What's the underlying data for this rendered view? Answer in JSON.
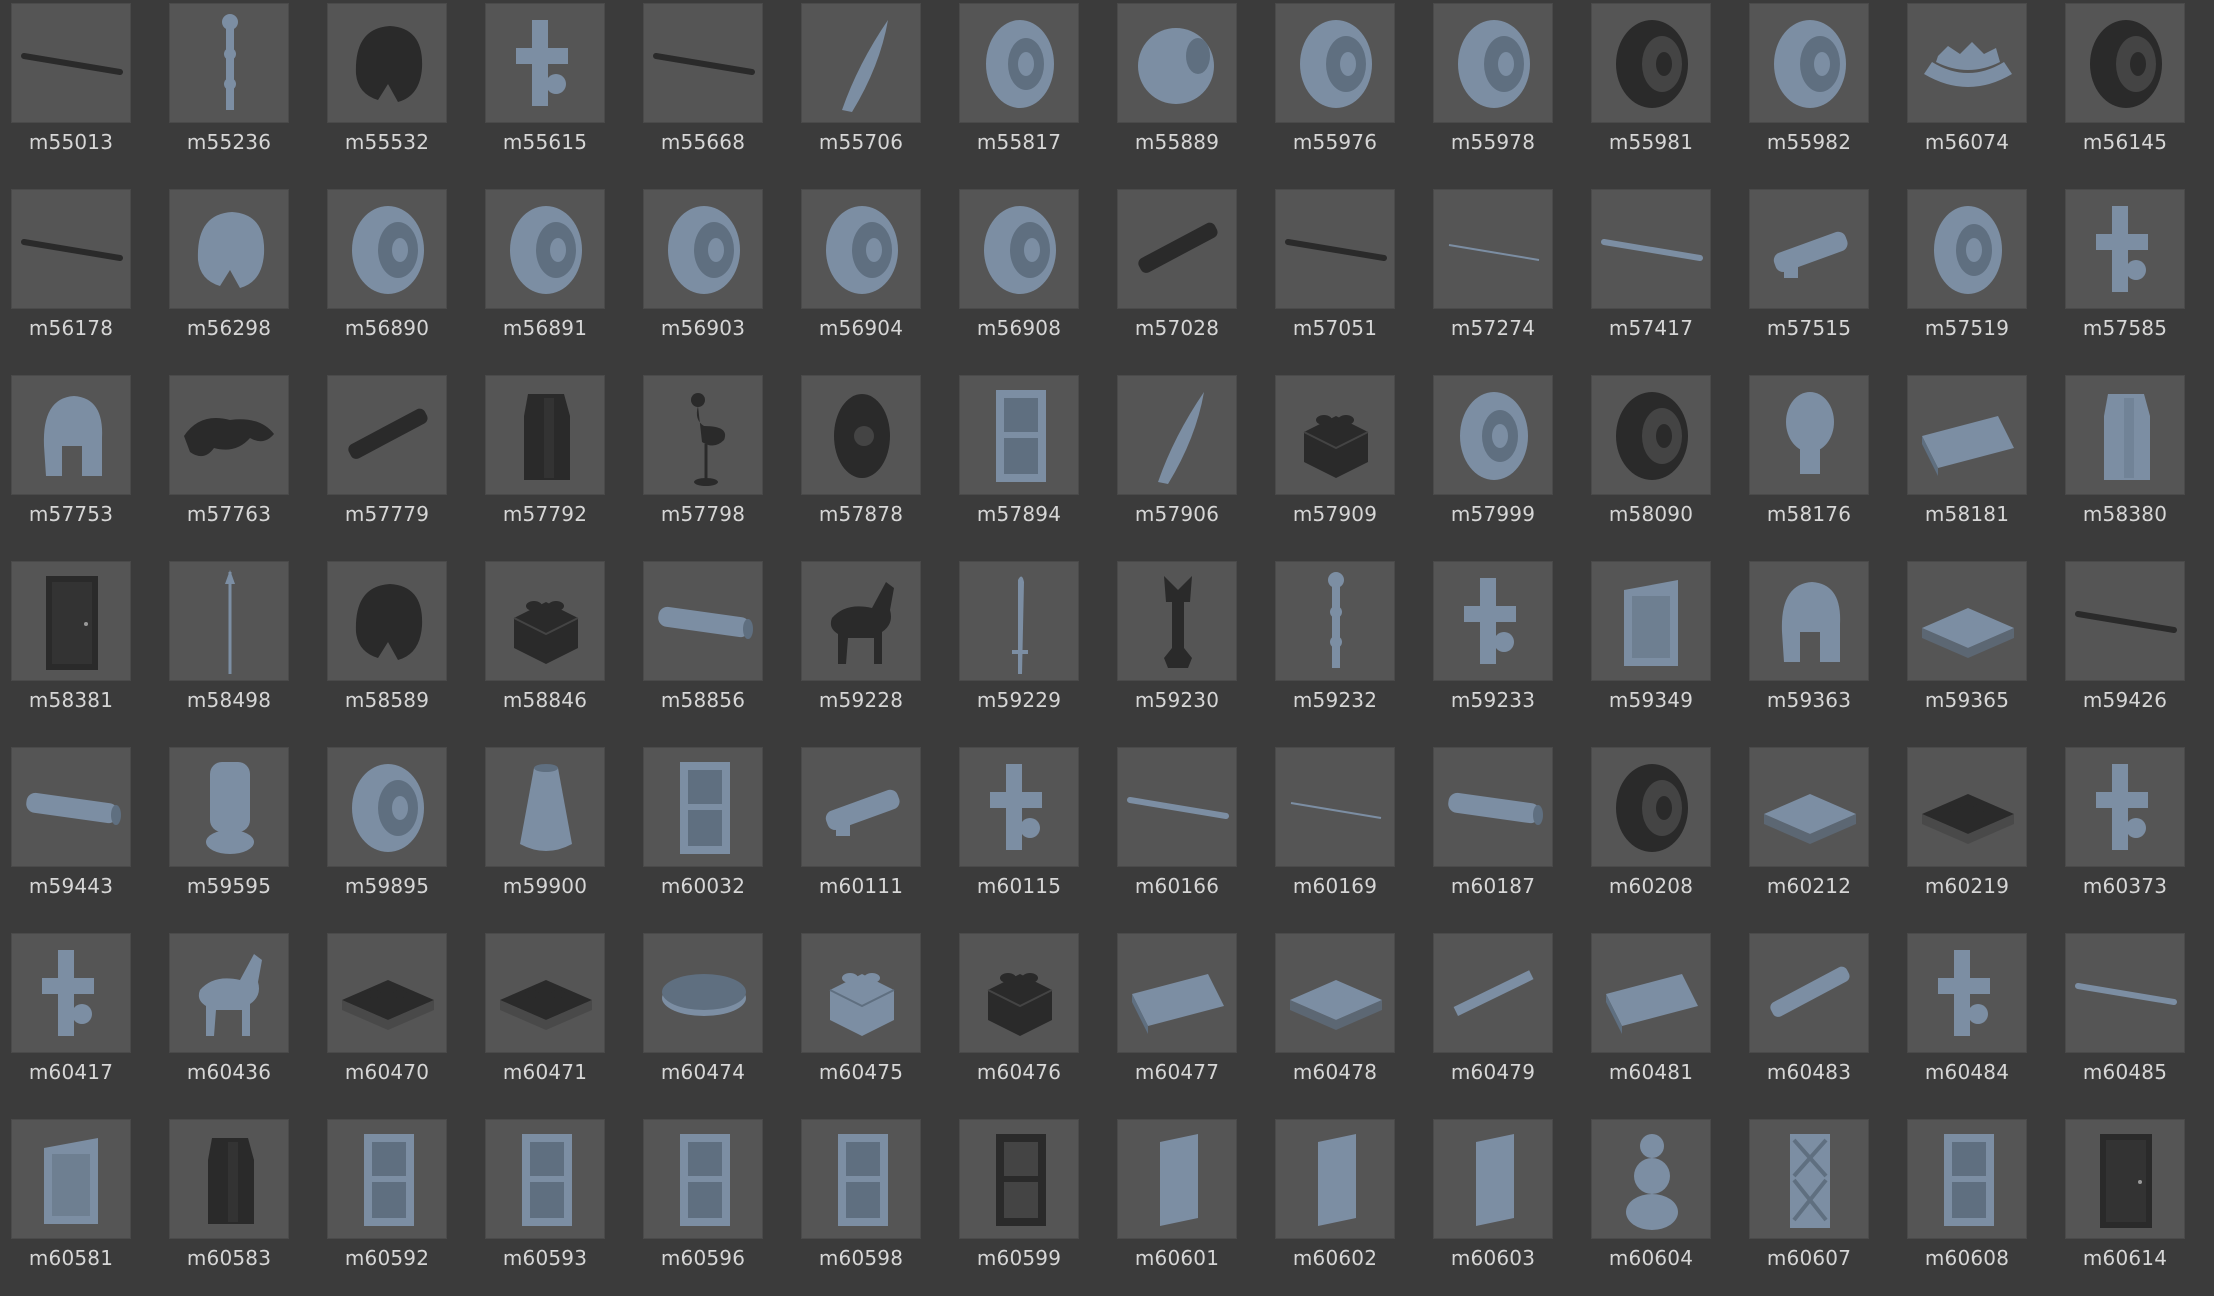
{
  "colors": {
    "background": "#3b3b3b",
    "thumb_bg": "#555555",
    "part_gray": "#7c8ea3",
    "part_dark": "#2a2a2a",
    "label": "#d6d6d6"
  },
  "items": [
    {
      "id": "m55013",
      "icon": "rod-icon",
      "tone": "dark"
    },
    {
      "id": "m55236",
      "icon": "staff-icon",
      "tone": "gray"
    },
    {
      "id": "m55532",
      "icon": "hair-icon",
      "tone": "dark"
    },
    {
      "id": "m55615",
      "icon": "bracket-icon",
      "tone": "gray"
    },
    {
      "id": "m55668",
      "icon": "rod-icon",
      "tone": "dark"
    },
    {
      "id": "m55706",
      "icon": "blade-icon",
      "tone": "gray"
    },
    {
      "id": "m55817",
      "icon": "wheel-icon",
      "tone": "gray"
    },
    {
      "id": "m55889",
      "icon": "sphere-icon",
      "tone": "gray"
    },
    {
      "id": "m55976",
      "icon": "tire-icon",
      "tone": "gray"
    },
    {
      "id": "m55978",
      "icon": "tire-icon",
      "tone": "gray"
    },
    {
      "id": "m55981",
      "icon": "tire-icon",
      "tone": "dark"
    },
    {
      "id": "m55982",
      "icon": "tire-icon",
      "tone": "gray"
    },
    {
      "id": "m56074",
      "icon": "crown-icon",
      "tone": "gray"
    },
    {
      "id": "m56145",
      "icon": "tire-icon",
      "tone": "dark"
    },
    {
      "id": "m56178",
      "icon": "rod-icon",
      "tone": "dark"
    },
    {
      "id": "m56298",
      "icon": "hair-icon",
      "tone": "gray"
    },
    {
      "id": "m56890",
      "icon": "tire-icon",
      "tone": "gray"
    },
    {
      "id": "m56891",
      "icon": "tire-icon",
      "tone": "gray"
    },
    {
      "id": "m56903",
      "icon": "tire-icon",
      "tone": "gray"
    },
    {
      "id": "m56904",
      "icon": "tire-icon",
      "tone": "gray"
    },
    {
      "id": "m56908",
      "icon": "tire-icon",
      "tone": "gray"
    },
    {
      "id": "m57028",
      "icon": "beam-icon",
      "tone": "dark"
    },
    {
      "id": "m57051",
      "icon": "rod-icon",
      "tone": "dark"
    },
    {
      "id": "m57274",
      "icon": "thin-rod-icon",
      "tone": "gray"
    },
    {
      "id": "m57417",
      "icon": "rod-icon",
      "tone": "gray"
    },
    {
      "id": "m57515",
      "icon": "gun-icon",
      "tone": "gray"
    },
    {
      "id": "m57519",
      "icon": "wheel-icon",
      "tone": "gray"
    },
    {
      "id": "m57585",
      "icon": "bracket-icon",
      "tone": "gray"
    },
    {
      "id": "m57753",
      "icon": "helmet-icon",
      "tone": "gray"
    },
    {
      "id": "m57763",
      "icon": "lizard-icon",
      "tone": "dark"
    },
    {
      "id": "m57779",
      "icon": "beam-icon",
      "tone": "dark"
    },
    {
      "id": "m57792",
      "icon": "tall-block-icon",
      "tone": "dark"
    },
    {
      "id": "m57798",
      "icon": "flamingo-icon",
      "tone": "dark"
    },
    {
      "id": "m57878",
      "icon": "disc-icon",
      "tone": "dark"
    },
    {
      "id": "m57894",
      "icon": "window-icon",
      "tone": "gray"
    },
    {
      "id": "m57906",
      "icon": "blade-icon",
      "tone": "gray"
    },
    {
      "id": "m57909",
      "icon": "brick-icon",
      "tone": "dark"
    },
    {
      "id": "m57999",
      "icon": "wheel-icon",
      "tone": "gray"
    },
    {
      "id": "m58090",
      "icon": "tire-icon",
      "tone": "dark"
    },
    {
      "id": "m58176",
      "icon": "head-icon",
      "tone": "gray"
    },
    {
      "id": "m58181",
      "icon": "slope-icon",
      "tone": "gray"
    },
    {
      "id": "m58380",
      "icon": "tall-block-icon",
      "tone": "gray"
    },
    {
      "id": "m58381",
      "icon": "door-icon",
      "tone": "dark"
    },
    {
      "id": "m58498",
      "icon": "spear-icon",
      "tone": "gray"
    },
    {
      "id": "m58589",
      "icon": "hair-icon",
      "tone": "dark"
    },
    {
      "id": "m58846",
      "icon": "brick-icon",
      "tone": "dark"
    },
    {
      "id": "m58856",
      "icon": "tube-icon",
      "tone": "gray"
    },
    {
      "id": "m59228",
      "icon": "horse-icon",
      "tone": "dark"
    },
    {
      "id": "m59229",
      "icon": "sword-icon",
      "tone": "gray"
    },
    {
      "id": "m59230",
      "icon": "arm-icon",
      "tone": "dark"
    },
    {
      "id": "m59232",
      "icon": "staff-icon",
      "tone": "gray"
    },
    {
      "id": "m59233",
      "icon": "bracket-icon",
      "tone": "gray"
    },
    {
      "id": "m59349",
      "icon": "panel-icon",
      "tone": "gray"
    },
    {
      "id": "m59363",
      "icon": "helmet-icon",
      "tone": "gray"
    },
    {
      "id": "m59365",
      "icon": "plate-icon",
      "tone": "gray"
    },
    {
      "id": "m59426",
      "icon": "rod-icon",
      "tone": "dark"
    },
    {
      "id": "m59443",
      "icon": "tube-icon",
      "tone": "gray"
    },
    {
      "id": "m59595",
      "icon": "leg-icon",
      "tone": "gray"
    },
    {
      "id": "m59895",
      "icon": "tire-icon",
      "tone": "gray"
    },
    {
      "id": "m59900",
      "icon": "cone-icon",
      "tone": "gray"
    },
    {
      "id": "m60032",
      "icon": "window-icon",
      "tone": "gray"
    },
    {
      "id": "m60111",
      "icon": "gun-icon",
      "tone": "gray"
    },
    {
      "id": "m60115",
      "icon": "bracket-icon",
      "tone": "gray"
    },
    {
      "id": "m60166",
      "icon": "rod-icon",
      "tone": "gray"
    },
    {
      "id": "m60169",
      "icon": "thin-rod-icon",
      "tone": "gray"
    },
    {
      "id": "m60187",
      "icon": "tube-icon",
      "tone": "gray"
    },
    {
      "id": "m60208",
      "icon": "tire-icon",
      "tone": "dark"
    },
    {
      "id": "m60212",
      "icon": "plate-icon",
      "tone": "gray"
    },
    {
      "id": "m60219",
      "icon": "plate-icon",
      "tone": "dark"
    },
    {
      "id": "m60373",
      "icon": "bracket-icon",
      "tone": "gray"
    },
    {
      "id": "m60417",
      "icon": "bracket-icon",
      "tone": "gray"
    },
    {
      "id": "m60436",
      "icon": "horse-icon",
      "tone": "gray"
    },
    {
      "id": "m60470",
      "icon": "plate-icon",
      "tone": "dark"
    },
    {
      "id": "m60471",
      "icon": "plate-icon",
      "tone": "dark"
    },
    {
      "id": "m60474",
      "icon": "round-plate-icon",
      "tone": "gray"
    },
    {
      "id": "m60475",
      "icon": "brick-icon",
      "tone": "gray"
    },
    {
      "id": "m60476",
      "icon": "brick-icon",
      "tone": "dark"
    },
    {
      "id": "m60477",
      "icon": "slope-icon",
      "tone": "gray"
    },
    {
      "id": "m60478",
      "icon": "plate-icon",
      "tone": "gray"
    },
    {
      "id": "m60479",
      "icon": "thin-plate-icon",
      "tone": "gray"
    },
    {
      "id": "m60481",
      "icon": "slope-icon",
      "tone": "gray"
    },
    {
      "id": "m60483",
      "icon": "beam-icon",
      "tone": "gray"
    },
    {
      "id": "m60484",
      "icon": "bracket-icon",
      "tone": "gray"
    },
    {
      "id": "m60485",
      "icon": "rod-icon",
      "tone": "gray"
    },
    {
      "id": "m60581",
      "icon": "panel-icon",
      "tone": "gray"
    },
    {
      "id": "m60583",
      "icon": "tall-block-icon",
      "tone": "dark"
    },
    {
      "id": "m60592",
      "icon": "window-icon",
      "tone": "gray"
    },
    {
      "id": "m60593",
      "icon": "window-icon",
      "tone": "gray"
    },
    {
      "id": "m60596",
      "icon": "window-icon",
      "tone": "gray"
    },
    {
      "id": "m60598",
      "icon": "window-icon",
      "tone": "gray"
    },
    {
      "id": "m60599",
      "icon": "window-icon",
      "tone": "dark"
    },
    {
      "id": "m60601",
      "icon": "glass-icon",
      "tone": "gray"
    },
    {
      "id": "m60602",
      "icon": "glass-icon",
      "tone": "gray"
    },
    {
      "id": "m60603",
      "icon": "glass-icon",
      "tone": "gray"
    },
    {
      "id": "m60604",
      "icon": "snowman-icon",
      "tone": "gray"
    },
    {
      "id": "m60607",
      "icon": "lattice-icon",
      "tone": "gray"
    },
    {
      "id": "m60608",
      "icon": "window-icon",
      "tone": "gray"
    },
    {
      "id": "m60614",
      "icon": "door-icon",
      "tone": "dark"
    }
  ]
}
